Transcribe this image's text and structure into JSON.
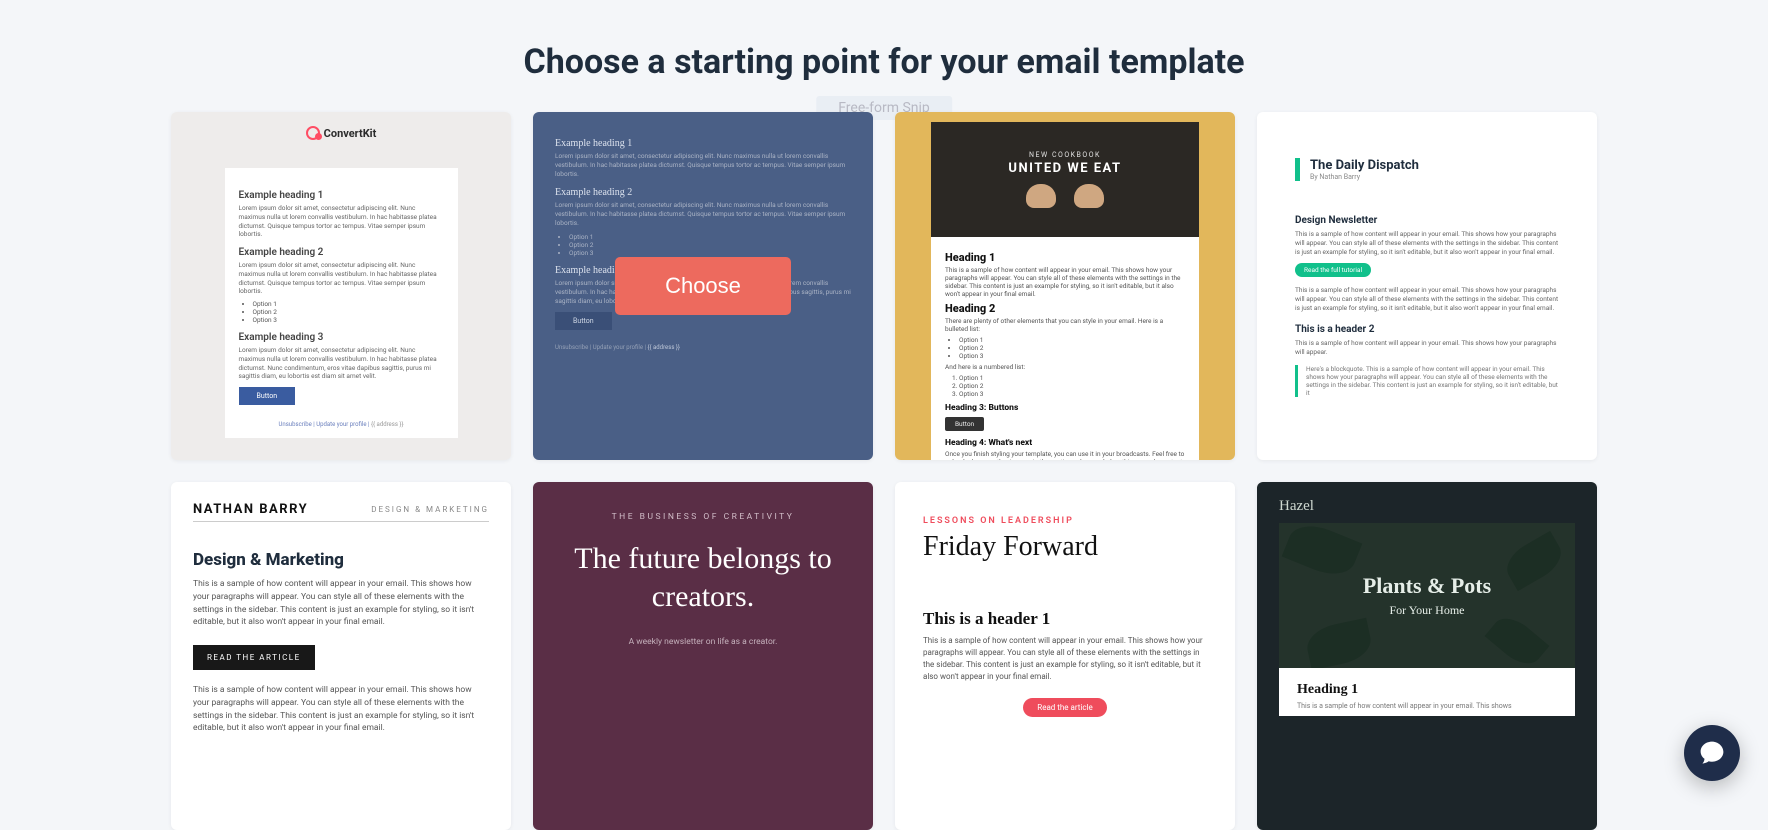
{
  "page_title": "Choose a starting point for your email template",
  "ghost_label": "Free-form Snip",
  "choose_label": "Choose",
  "lorem_short": "Lorem ipsum dolor sit amet, consectetur adipiscing elit. Nunc maximus nulla ut lorem convallis vestibulum. In hac habitasse platea dictumst. Quisque tempus tortor ac tempus. Vitae semper ipsum lobortis.",
  "lorem_long": "Lorem ipsum dolor sit amet, consectetur adipiscing elit. Nunc maximus nulla ut lorem convallis vestibulum. In hac habitasse platea dictumst. Nunc condimentum, eros vitae dapibus sagittis, purus mi sagittis diam, eu lobortis est diam sit amet velit.",
  "sample_paragraph": "This is a sample of how content will appear in your email. This shows how your paragraphs will appear. You can style all of these elements with the settings in the sidebar. This content is just an example for styling, so it isn't editable, but it also won't appear in your final email.",
  "options": {
    "o1": "Option 1",
    "o2": "Option 2",
    "o3": "Option 3"
  },
  "card1": {
    "brand": "ConvertKit",
    "h1": "Example heading 1",
    "h2": "Example heading 2",
    "h3": "Example heading 3",
    "button": "Button",
    "unsubscribe": "Unsubscribe",
    "update": "Update your profile",
    "address": "{{ address }}"
  },
  "card2": {
    "h1": "Example heading 1",
    "h2": "Example heading 2",
    "h3": "Example heading 3",
    "button": "Button",
    "foot_pre": "Unsubscribe | Update your profile |",
    "foot_addr": "{{ address }}"
  },
  "card3": {
    "hero_small": "NEW COOKBOOK",
    "hero_title": "UNITED WE EAT",
    "h1": "Heading 1",
    "h2": "Heading 2",
    "p2": "There are plenty of other elements that you can style in your email. Here is a bulleted list:",
    "numbered_intro": "And here is a numbered list:",
    "h3": "Heading 3: Buttons",
    "button": "Button",
    "h4": "Heading 4: What's next",
    "p4": "Once you finish styling your template, you can use it in your broadcasts. Feel free to upload a logo or other images in the sections above or below this example content."
  },
  "card4": {
    "title": "The Daily Dispatch",
    "byline": "By Nathan Barry",
    "h1": "Design Newsletter",
    "cta": "Read the full tutorial",
    "h2": "This is a header 2",
    "p_short": "This is a sample of how content will appear in your email. This shows how your paragraphs will appear.",
    "blockquote": "Here's a blockquote. This is a sample of how content will appear in your email. This shows how your paragraphs will appear. You can style all of these elements with the settings in the sidebar. This content is just an example for styling, so it isn't editable, but it"
  },
  "card5": {
    "name": "NATHAN BARRY",
    "tag": "DESIGN & MARKETING",
    "h1": "Design & Marketing",
    "cta": "READ THE ARTICLE",
    "p2_partial": "This is a sample of how content will appear in your email. This shows how your paragraphs will appear. You can style all of these elements with the settings in the sidebar. This content is just an example for styling, so it isn't editable, but it also won't appear in your final email."
  },
  "card6": {
    "kicker": "THE BUSINESS OF CREATIVITY",
    "headline": "The future belongs to creators.",
    "tagline": "A weekly newsletter on life as a creator."
  },
  "card7": {
    "kicker": "LESSONS ON LEADERSHIP",
    "title": "Friday Forward",
    "h1": "This is a header 1",
    "cta": "Read the article"
  },
  "card8": {
    "brand": "Hazel",
    "hero_title": "Plants & Pots",
    "hero_sub": "For Your Home",
    "h1": "Heading 1",
    "p_partial": "This is a sample of how content will appear in your email. This shows"
  }
}
